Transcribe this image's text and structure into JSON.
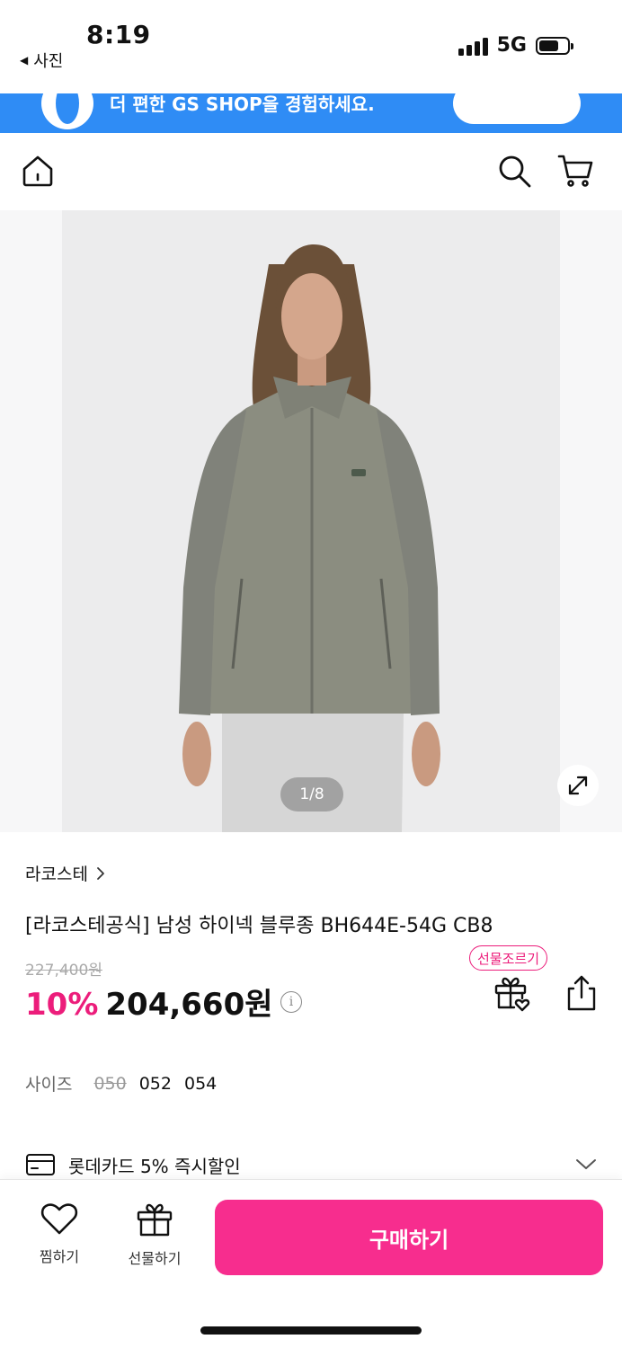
{
  "status_bar": {
    "time": "8:19",
    "back_label": "사진",
    "network": "5G"
  },
  "promo_banner": {
    "text": "더 편한 GS SHOP을 경험하세요."
  },
  "product": {
    "image_counter": "1/8",
    "brand": "라코스테",
    "title": "[라코스테공식] 남성 하이넥 블루종 BH644E-54G CB8",
    "original_price": "227,400원",
    "discount": "10%",
    "price": "204,660원",
    "gift_badge": "선물조르기",
    "size_label": "사이즈",
    "sizes": [
      {
        "label": "050",
        "available": false
      },
      {
        "label": "052",
        "available": true
      },
      {
        "label": "054",
        "available": true
      }
    ],
    "card_promo": "롯데카드 5% 즉시할인"
  },
  "bottom_bar": {
    "wish_label": "찜하기",
    "gift_label": "선물하기",
    "buy_label": "구매하기"
  },
  "colors": {
    "accent_pink": "#f72d8e",
    "discount_pink": "#ec1d7b",
    "banner_blue": "#2f8cf5"
  },
  "icons": [
    "home-icon",
    "search-icon",
    "cart-icon",
    "expand-icon",
    "info-icon",
    "gift-icon",
    "share-icon",
    "card-icon",
    "chevron-down-icon",
    "heart-icon",
    "battery-icon",
    "signal-icon"
  ]
}
